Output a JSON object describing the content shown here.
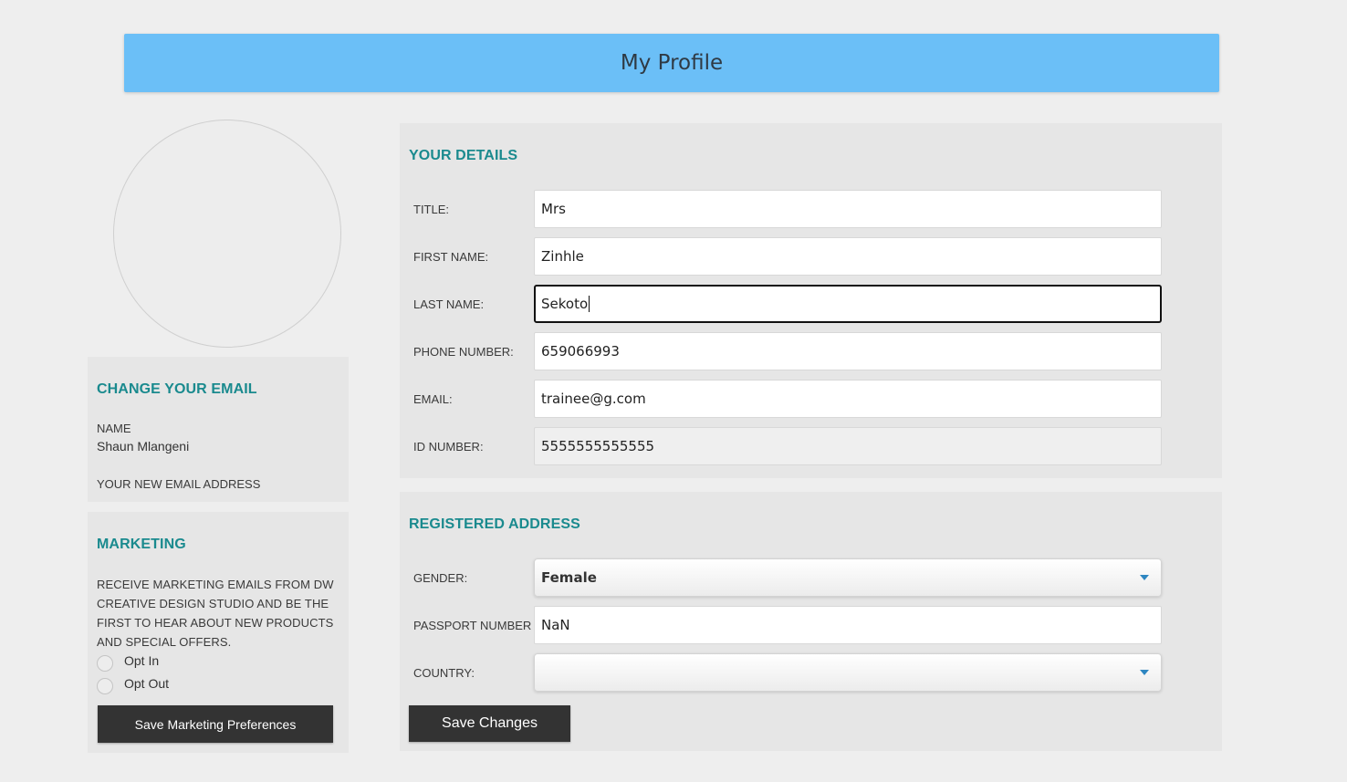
{
  "header": {
    "title": "My Profile"
  },
  "change_email": {
    "title": "CHANGE YOUR EMAIL",
    "name_label": "NAME",
    "name_value": "Shaun Mlangeni",
    "new_email_label": "YOUR NEW EMAIL ADDRESS"
  },
  "marketing": {
    "title": "MARKETING",
    "description": "RECEIVE MARKETING EMAILS FROM DW CREATIVE DESIGN STUDIO AND BE THE FIRST TO HEAR ABOUT NEW PRODUCTS AND SPECIAL OFFERS.",
    "options": [
      {
        "label": "Opt In",
        "selected": false
      },
      {
        "label": "Opt Out",
        "selected": false
      }
    ],
    "save_label": "Save Marketing Preferences"
  },
  "details": {
    "title": "YOUR DETAILS",
    "fields": [
      {
        "label": "TITLE:",
        "value": "Mrs"
      },
      {
        "label": "FIRST NAME:",
        "value": "Zinhle"
      },
      {
        "label": "LAST NAME:",
        "value": "Sekoto"
      },
      {
        "label": "PHONE NUMBER:",
        "value": "659066993"
      },
      {
        "label": "EMAIL:",
        "value": "trainee@g.com"
      },
      {
        "label": "ID NUMBER:",
        "value": "5555555555555"
      }
    ]
  },
  "address": {
    "title": "REGISTERED ADDRESS",
    "gender_label": "GENDER:",
    "gender_value": "Female",
    "passport_label": "PASSPORT NUMBER",
    "passport_value": "NaN",
    "country_label": "COUNTRY:",
    "country_value": "",
    "save_label": "Save Changes"
  },
  "colors": {
    "header_bg": "#6bbff7",
    "section_title": "#1a8a8e",
    "button_bg": "#333333",
    "select_arrow": "#2e86c1"
  },
  "icons": {
    "select_arrow": "caret-down-icon"
  }
}
